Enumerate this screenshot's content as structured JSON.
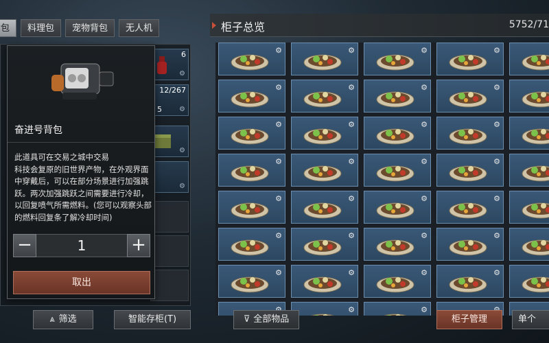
{
  "left_tabs": [
    "随身背包",
    "料理包",
    "宠物背包",
    "无人机"
  ],
  "left_tab_visible_first": "背包",
  "inventory": {
    "counts": [
      "6",
      "12/267",
      "5"
    ]
  },
  "popup": {
    "item_name": "奋进号背包",
    "description": "此道具可在交易之城中交易\n科技会复原的旧世界产物，在外观界面中穿戴后，可以在部分场景进行加强跳跃。两次加强跳跃之间需要进行冷却，以回复喷气所需燃料。(您可以观察头部的燃料回复条了解冷却时间)",
    "quantity": "1",
    "minus_label": "−",
    "plus_label": "+",
    "takeout_label": "取出"
  },
  "left_bottom": {
    "filter_label": "筛选",
    "smart_store_label": "智能存柜(T)"
  },
  "cabinet": {
    "title": "柜子总览",
    "count": "5752/71",
    "filter_all_label": "全部物品",
    "manage_label": "柜子管理",
    "single_label": "单个"
  },
  "colors": {
    "accent_red": "#8a4a38",
    "slot_blue": "#3a5978",
    "title_marker": "#c8503a"
  }
}
